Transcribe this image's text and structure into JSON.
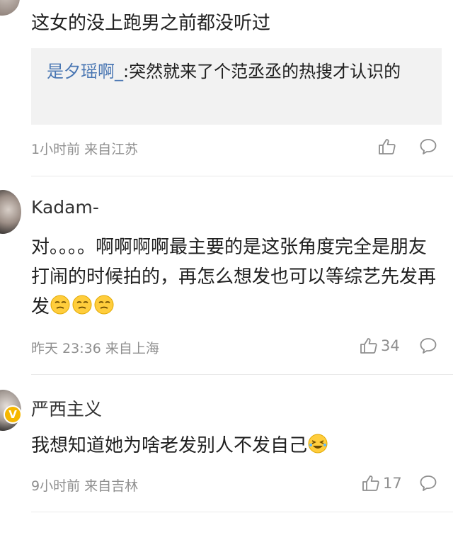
{
  "comments": [
    {
      "text": "这女的没上跑男之前都没听过",
      "quote": {
        "name": "是夕瑶啊_",
        "text": ":突然就来了个范丞丞的热搜才认识的"
      },
      "time": "1小时前",
      "location": "来自江苏",
      "likes": ""
    },
    {
      "username": "Kadam-",
      "text": "对。。。。啊啊啊啊最主要的是这张角度完全是朋友打闹的时候拍的，再怎么想发也可以等综艺先发再发",
      "time": "昨天 23:36",
      "location": "来自上海",
      "likes": "34"
    },
    {
      "username": "严西主义",
      "text": "我想知道她为啥老发别人不发自己",
      "time": "9小时前",
      "location": "来自吉林",
      "likes": "17"
    }
  ],
  "icons": {
    "like": "thumbs-up-icon",
    "reply": "comment-bubble-icon",
    "emoji_thinking": "thinking-face-emoji",
    "emoji_laugh": "laughing-face-emoji",
    "verified": "verified-badge-icon"
  },
  "colors": {
    "link": "#4a77b3",
    "meta": "#8f8f8f",
    "quote_bg": "#f2f2f2",
    "verified": "#f6b700"
  }
}
